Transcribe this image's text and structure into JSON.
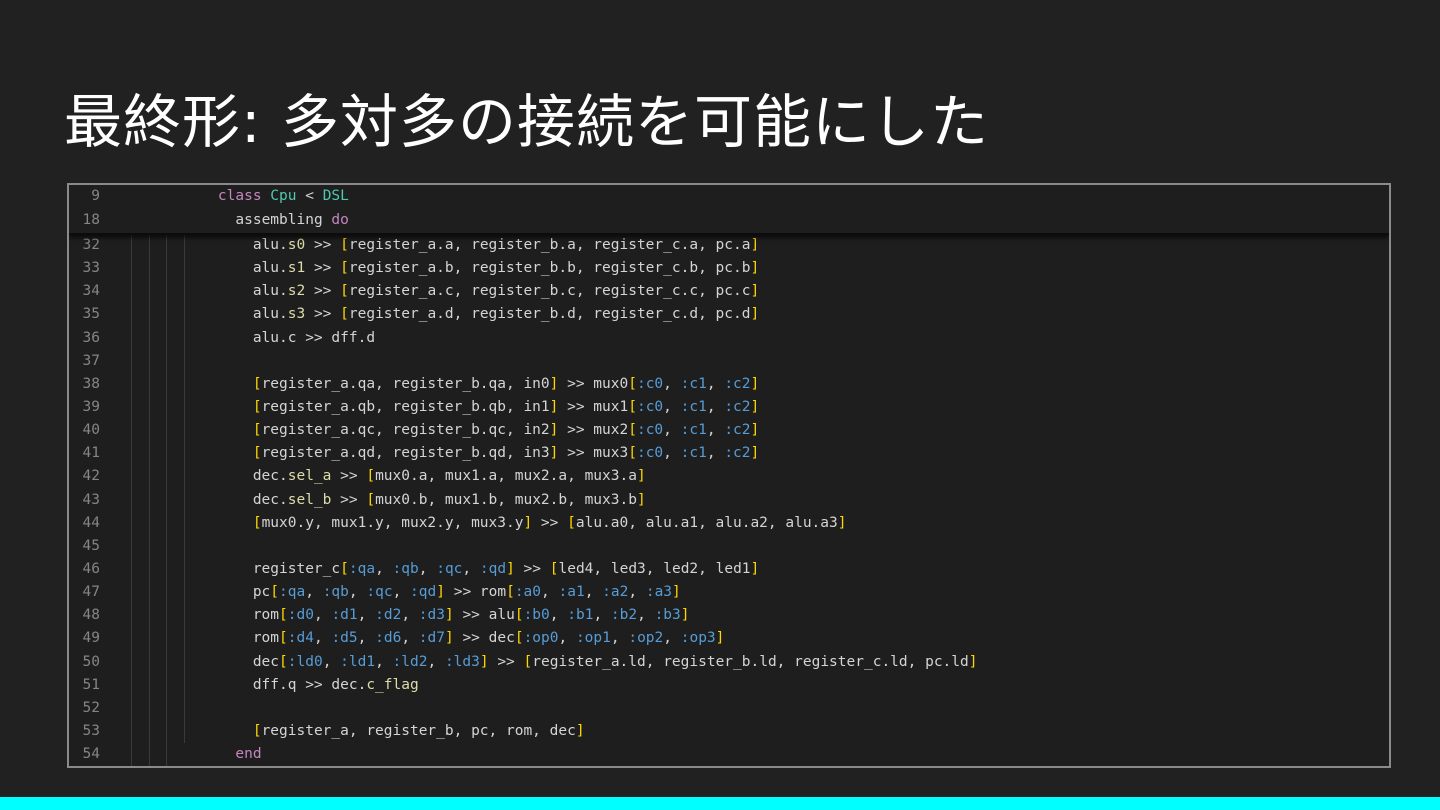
{
  "slide": {
    "title": "最終形: 多対多の接続を可能にした",
    "accent_bar_color": "#00ffff"
  },
  "colors": {
    "keyword": "#c586c0",
    "class": "#4ec9b0",
    "method": "#dcdcaa",
    "bracket": "#ffd700",
    "symbol": "#569cd6",
    "plain": "#d4d4d4",
    "line_number": "#858585"
  },
  "editor": {
    "sticky_lines": [
      {
        "number": "9",
        "indent": 4,
        "tokens": [
          [
            "kw",
            "class"
          ],
          [
            "pl",
            " "
          ],
          [
            "cls",
            "Cpu"
          ],
          [
            "pl",
            " < "
          ],
          [
            "cls",
            "DSL"
          ]
        ]
      },
      {
        "number": "18",
        "indent": 6,
        "tokens": [
          [
            "pl",
            "assembling "
          ],
          [
            "kw",
            "do"
          ]
        ]
      }
    ],
    "lines": [
      {
        "number": "32",
        "indent": 8,
        "tokens": [
          [
            "pl",
            "alu."
          ],
          [
            "fn",
            "s0"
          ],
          [
            "pl",
            " >> "
          ],
          [
            "br",
            "["
          ],
          [
            "pl",
            "register_a.a, register_b.a, register_c.a, pc.a"
          ],
          [
            "br",
            "]"
          ]
        ]
      },
      {
        "number": "33",
        "indent": 8,
        "tokens": [
          [
            "pl",
            "alu."
          ],
          [
            "fn",
            "s1"
          ],
          [
            "pl",
            " >> "
          ],
          [
            "br",
            "["
          ],
          [
            "pl",
            "register_a.b, register_b.b, register_c.b, pc.b"
          ],
          [
            "br",
            "]"
          ]
        ]
      },
      {
        "number": "34",
        "indent": 8,
        "tokens": [
          [
            "pl",
            "alu."
          ],
          [
            "fn",
            "s2"
          ],
          [
            "pl",
            " >> "
          ],
          [
            "br",
            "["
          ],
          [
            "pl",
            "register_a.c, register_b.c, register_c.c, pc.c"
          ],
          [
            "br",
            "]"
          ]
        ]
      },
      {
        "number": "35",
        "indent": 8,
        "tokens": [
          [
            "pl",
            "alu."
          ],
          [
            "fn",
            "s3"
          ],
          [
            "pl",
            " >> "
          ],
          [
            "br",
            "["
          ],
          [
            "pl",
            "register_a.d, register_b.d, register_c.d, pc.d"
          ],
          [
            "br",
            "]"
          ]
        ]
      },
      {
        "number": "36",
        "indent": 8,
        "tokens": [
          [
            "pl",
            "alu.c >> dff.d"
          ]
        ]
      },
      {
        "number": "37",
        "indent": 8,
        "tokens": []
      },
      {
        "number": "38",
        "indent": 8,
        "tokens": [
          [
            "br",
            "["
          ],
          [
            "pl",
            "register_a.qa, register_b.qa, in0"
          ],
          [
            "br",
            "]"
          ],
          [
            "pl",
            " >> mux0"
          ],
          [
            "br",
            "["
          ],
          [
            "sym",
            ":c0"
          ],
          [
            "pl",
            ", "
          ],
          [
            "sym",
            ":c1"
          ],
          [
            "pl",
            ", "
          ],
          [
            "sym",
            ":c2"
          ],
          [
            "br",
            "]"
          ]
        ]
      },
      {
        "number": "39",
        "indent": 8,
        "tokens": [
          [
            "br",
            "["
          ],
          [
            "pl",
            "register_a.qb, register_b.qb, in1"
          ],
          [
            "br",
            "]"
          ],
          [
            "pl",
            " >> mux1"
          ],
          [
            "br",
            "["
          ],
          [
            "sym",
            ":c0"
          ],
          [
            "pl",
            ", "
          ],
          [
            "sym",
            ":c1"
          ],
          [
            "pl",
            ", "
          ],
          [
            "sym",
            ":c2"
          ],
          [
            "br",
            "]"
          ]
        ]
      },
      {
        "number": "40",
        "indent": 8,
        "tokens": [
          [
            "br",
            "["
          ],
          [
            "pl",
            "register_a.qc, register_b.qc, in2"
          ],
          [
            "br",
            "]"
          ],
          [
            "pl",
            " >> mux2"
          ],
          [
            "br",
            "["
          ],
          [
            "sym",
            ":c0"
          ],
          [
            "pl",
            ", "
          ],
          [
            "sym",
            ":c1"
          ],
          [
            "pl",
            ", "
          ],
          [
            "sym",
            ":c2"
          ],
          [
            "br",
            "]"
          ]
        ]
      },
      {
        "number": "41",
        "indent": 8,
        "tokens": [
          [
            "br",
            "["
          ],
          [
            "pl",
            "register_a.qd, register_b.qd, in3"
          ],
          [
            "br",
            "]"
          ],
          [
            "pl",
            " >> mux3"
          ],
          [
            "br",
            "["
          ],
          [
            "sym",
            ":c0"
          ],
          [
            "pl",
            ", "
          ],
          [
            "sym",
            ":c1"
          ],
          [
            "pl",
            ", "
          ],
          [
            "sym",
            ":c2"
          ],
          [
            "br",
            "]"
          ]
        ]
      },
      {
        "number": "42",
        "indent": 8,
        "tokens": [
          [
            "pl",
            "dec."
          ],
          [
            "fn",
            "sel_a"
          ],
          [
            "pl",
            " >> "
          ],
          [
            "br",
            "["
          ],
          [
            "pl",
            "mux0.a, mux1.a, mux2.a, mux3.a"
          ],
          [
            "br",
            "]"
          ]
        ]
      },
      {
        "number": "43",
        "indent": 8,
        "tokens": [
          [
            "pl",
            "dec."
          ],
          [
            "fn",
            "sel_b"
          ],
          [
            "pl",
            " >> "
          ],
          [
            "br",
            "["
          ],
          [
            "pl",
            "mux0.b, mux1.b, mux2.b, mux3.b"
          ],
          [
            "br",
            "]"
          ]
        ]
      },
      {
        "number": "44",
        "indent": 8,
        "tokens": [
          [
            "br",
            "["
          ],
          [
            "pl",
            "mux0.y, mux1.y, mux2.y, mux3.y"
          ],
          [
            "br",
            "]"
          ],
          [
            "pl",
            " >> "
          ],
          [
            "br",
            "["
          ],
          [
            "pl",
            "alu.a0, alu.a1, alu.a2, alu.a3"
          ],
          [
            "br",
            "]"
          ]
        ]
      },
      {
        "number": "45",
        "indent": 8,
        "tokens": []
      },
      {
        "number": "46",
        "indent": 8,
        "tokens": [
          [
            "pl",
            "register_c"
          ],
          [
            "br",
            "["
          ],
          [
            "sym",
            ":qa"
          ],
          [
            "pl",
            ", "
          ],
          [
            "sym",
            ":qb"
          ],
          [
            "pl",
            ", "
          ],
          [
            "sym",
            ":qc"
          ],
          [
            "pl",
            ", "
          ],
          [
            "sym",
            ":qd"
          ],
          [
            "br",
            "]"
          ],
          [
            "pl",
            " >> "
          ],
          [
            "br",
            "["
          ],
          [
            "pl",
            "led4, led3, led2, led1"
          ],
          [
            "br",
            "]"
          ]
        ]
      },
      {
        "number": "47",
        "indent": 8,
        "tokens": [
          [
            "pl",
            "pc"
          ],
          [
            "br",
            "["
          ],
          [
            "sym",
            ":qa"
          ],
          [
            "pl",
            ", "
          ],
          [
            "sym",
            ":qb"
          ],
          [
            "pl",
            ", "
          ],
          [
            "sym",
            ":qc"
          ],
          [
            "pl",
            ", "
          ],
          [
            "sym",
            ":qd"
          ],
          [
            "br",
            "]"
          ],
          [
            "pl",
            " >> rom"
          ],
          [
            "br",
            "["
          ],
          [
            "sym",
            ":a0"
          ],
          [
            "pl",
            ", "
          ],
          [
            "sym",
            ":a1"
          ],
          [
            "pl",
            ", "
          ],
          [
            "sym",
            ":a2"
          ],
          [
            "pl",
            ", "
          ],
          [
            "sym",
            ":a3"
          ],
          [
            "br",
            "]"
          ]
        ]
      },
      {
        "number": "48",
        "indent": 8,
        "tokens": [
          [
            "pl",
            "rom"
          ],
          [
            "br",
            "["
          ],
          [
            "sym",
            ":d0"
          ],
          [
            "pl",
            ", "
          ],
          [
            "sym",
            ":d1"
          ],
          [
            "pl",
            ", "
          ],
          [
            "sym",
            ":d2"
          ],
          [
            "pl",
            ", "
          ],
          [
            "sym",
            ":d3"
          ],
          [
            "br",
            "]"
          ],
          [
            "pl",
            " >> alu"
          ],
          [
            "br",
            "["
          ],
          [
            "sym",
            ":b0"
          ],
          [
            "pl",
            ", "
          ],
          [
            "sym",
            ":b1"
          ],
          [
            "pl",
            ", "
          ],
          [
            "sym",
            ":b2"
          ],
          [
            "pl",
            ", "
          ],
          [
            "sym",
            ":b3"
          ],
          [
            "br",
            "]"
          ]
        ]
      },
      {
        "number": "49",
        "indent": 8,
        "tokens": [
          [
            "pl",
            "rom"
          ],
          [
            "br",
            "["
          ],
          [
            "sym",
            ":d4"
          ],
          [
            "pl",
            ", "
          ],
          [
            "sym",
            ":d5"
          ],
          [
            "pl",
            ", "
          ],
          [
            "sym",
            ":d6"
          ],
          [
            "pl",
            ", "
          ],
          [
            "sym",
            ":d7"
          ],
          [
            "br",
            "]"
          ],
          [
            "pl",
            " >> dec"
          ],
          [
            "br",
            "["
          ],
          [
            "sym",
            ":op0"
          ],
          [
            "pl",
            ", "
          ],
          [
            "sym",
            ":op1"
          ],
          [
            "pl",
            ", "
          ],
          [
            "sym",
            ":op2"
          ],
          [
            "pl",
            ", "
          ],
          [
            "sym",
            ":op3"
          ],
          [
            "br",
            "]"
          ]
        ]
      },
      {
        "number": "50",
        "indent": 8,
        "tokens": [
          [
            "pl",
            "dec"
          ],
          [
            "br",
            "["
          ],
          [
            "sym",
            ":ld0"
          ],
          [
            "pl",
            ", "
          ],
          [
            "sym",
            ":ld1"
          ],
          [
            "pl",
            ", "
          ],
          [
            "sym",
            ":ld2"
          ],
          [
            "pl",
            ", "
          ],
          [
            "sym",
            ":ld3"
          ],
          [
            "br",
            "]"
          ],
          [
            "pl",
            " >> "
          ],
          [
            "br",
            "["
          ],
          [
            "pl",
            "register_a.ld, register_b.ld, register_c.ld, pc.ld"
          ],
          [
            "br",
            "]"
          ]
        ]
      },
      {
        "number": "51",
        "indent": 8,
        "tokens": [
          [
            "pl",
            "dff.q >> dec."
          ],
          [
            "fn",
            "c_flag"
          ]
        ]
      },
      {
        "number": "52",
        "indent": 8,
        "tokens": []
      },
      {
        "number": "53",
        "indent": 8,
        "tokens": [
          [
            "br",
            "["
          ],
          [
            "pl",
            "register_a, register_b, pc, rom, dec"
          ],
          [
            "br",
            "]"
          ]
        ]
      },
      {
        "number": "54",
        "indent": 6,
        "tokens": [
          [
            "kw",
            "end"
          ]
        ]
      }
    ]
  }
}
